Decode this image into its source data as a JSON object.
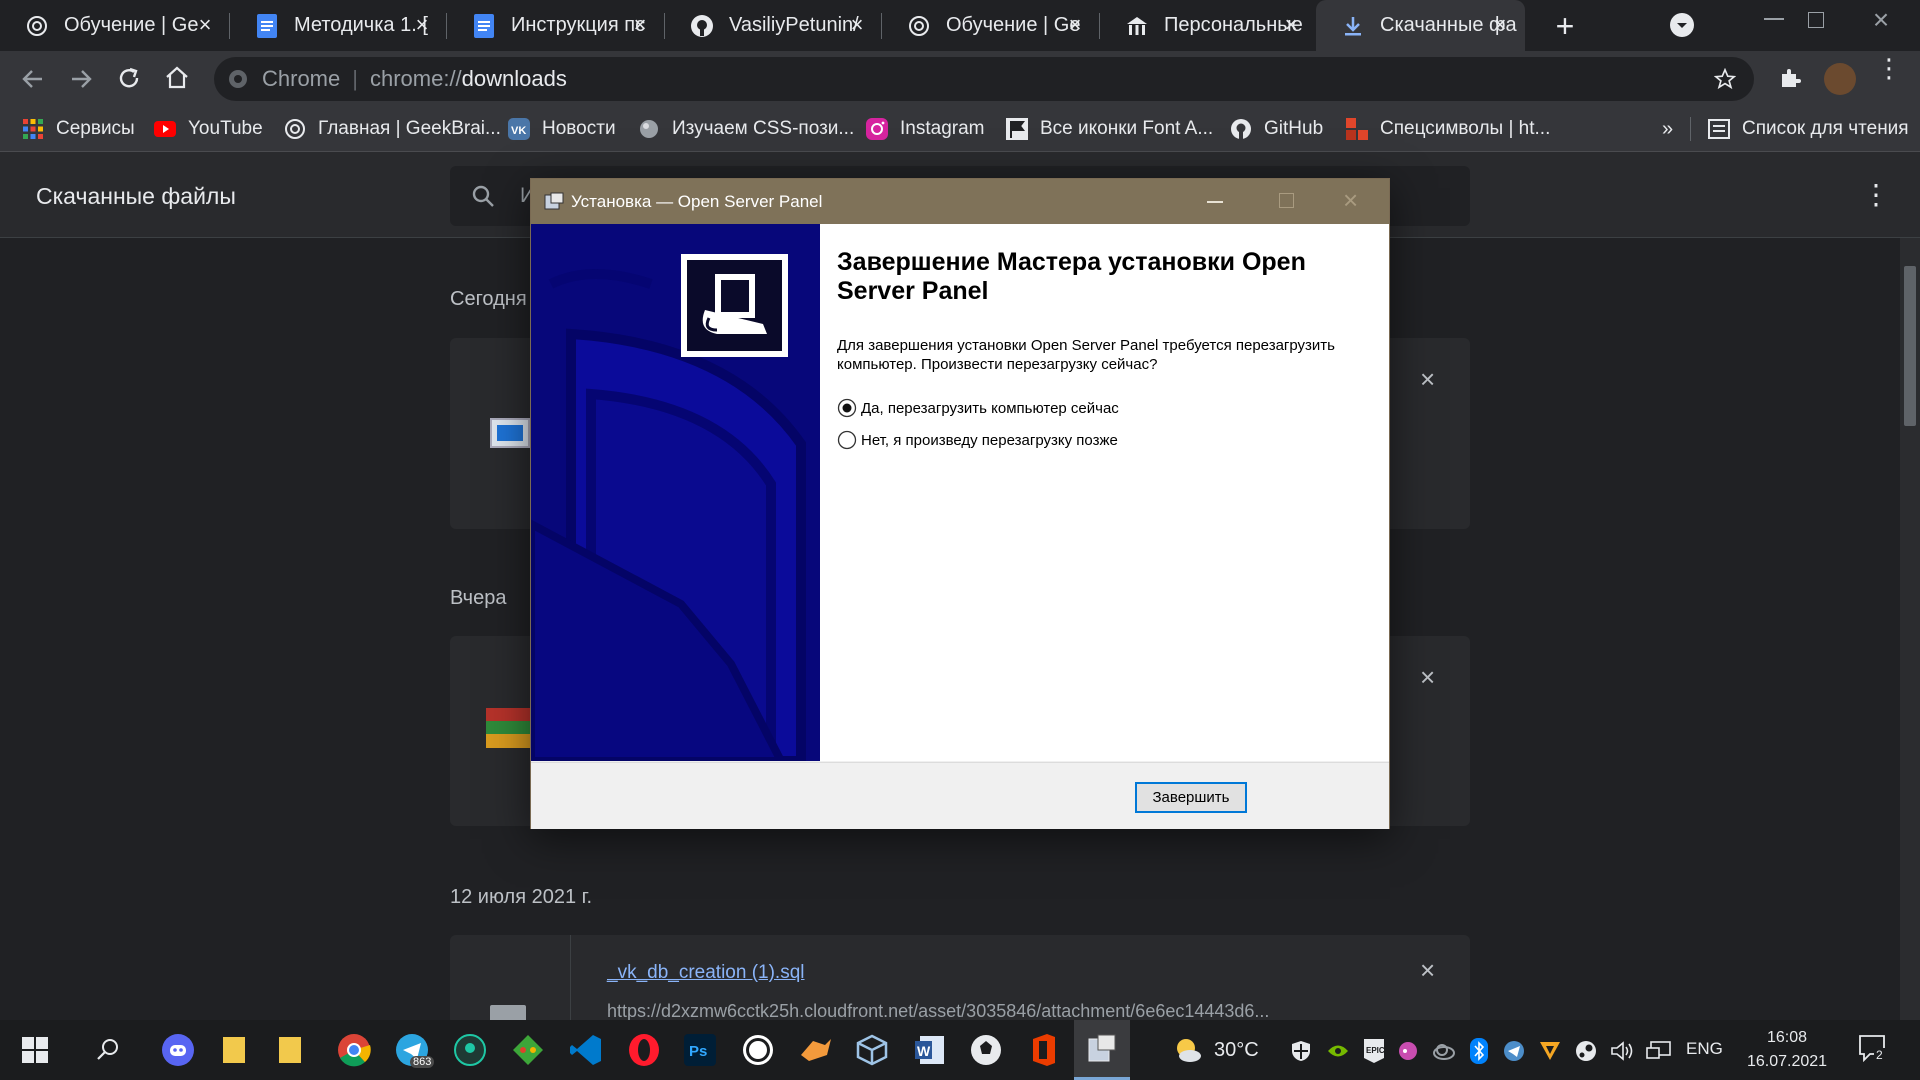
{
  "tabs": [
    {
      "title": "Обучение | Ge",
      "icon": "openai-icon"
    },
    {
      "title": "Методичка 1. [",
      "icon": "docs-icon"
    },
    {
      "title": "Инструкция пс",
      "icon": "docs-icon"
    },
    {
      "title": "VasiliyPetunin/",
      "icon": "github-icon"
    },
    {
      "title": "Обучение | Ge",
      "icon": "openai-icon"
    },
    {
      "title": "Персональные",
      "icon": "bank-icon"
    },
    {
      "title": "Скачанные фа",
      "icon": "download-icon"
    }
  ],
  "omnibox": {
    "scheme": "Chrome",
    "separator": "|",
    "url_prefix": "chrome://",
    "url_host": "downloads"
  },
  "bookmarks": [
    {
      "label": "Сервисы"
    },
    {
      "label": "YouTube"
    },
    {
      "label": "Главная | GeekBrai..."
    },
    {
      "label": "Новости"
    },
    {
      "label": "Изучаем CSS-пози..."
    },
    {
      "label": "Instagram"
    },
    {
      "label": "Все иконки Font A..."
    },
    {
      "label": "GitHub"
    },
    {
      "label": "Спецсимволы | ht..."
    }
  ],
  "bookmarks_overflow": "»",
  "reading_list": "Список для чтения",
  "downloads": {
    "page_title": "Скачанные файлы",
    "search_placeholder": "И",
    "sections": [
      {
        "label": "Сегодня"
      },
      {
        "label": "Вчера"
      },
      {
        "label": "12 июля 2021 г."
      }
    ],
    "file": {
      "name": "_vk_db_creation (1).sql",
      "url": "https://d2xzmw6cctk25h.cloudfront.net/asset/3035846/attachment/6e6ec14443d6..."
    }
  },
  "dialog": {
    "title": "Установка — Open Server Panel",
    "heading": "Завершение Мастера установки Open Server Panel",
    "description": "Для завершения установки Open Server Panel требуется перезагрузить компьютер. Произвести перезагрузку сейчас?",
    "option_yes": "Да, перезагрузить компьютер сейчас",
    "option_no": "Нет, я произведу перезагрузку позже",
    "selected": "yes",
    "finish_button": "Завершить"
  },
  "taskbar": {
    "telegram_badge": "863",
    "weather": "30°C",
    "language": "ENG",
    "time": "16:08",
    "date": "16.07.2021",
    "notification_count": "2"
  },
  "colors": {
    "chrome_bg": "#202124",
    "toolbar_bg": "#35363a",
    "dialog_title_bg": "#7f7259",
    "dialog_sidebar": "#0a0a8c",
    "link": "#8ab4f8"
  }
}
